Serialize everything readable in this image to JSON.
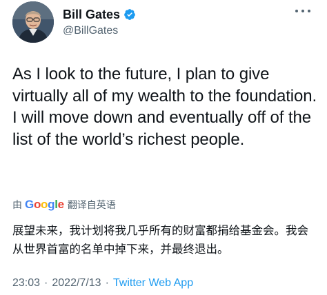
{
  "author": {
    "display_name": "Bill Gates",
    "handle": "@BillGates",
    "verified": true,
    "avatar_icon": "profile-photo"
  },
  "tweet": {
    "text": "As I look to the future, I plan to give virtually all of my wealth to the foundation. I will move down and eventually off of the list of the world’s richest people."
  },
  "translation": {
    "by_label": "由",
    "provider_name": "Google",
    "action_label": "翻译自英语",
    "translated_text": "展望未来，我计划将我几乎所有的财富都捐给基金会。我会从世界首富的名单中掉下来，并最终退出。"
  },
  "meta": {
    "time": "23:03",
    "separator": "·",
    "date": "2022/7/13",
    "source": "Twitter Web App"
  },
  "colors": {
    "text_primary": "#0f1419",
    "text_secondary": "#536471",
    "accent": "#1d9bf0"
  }
}
